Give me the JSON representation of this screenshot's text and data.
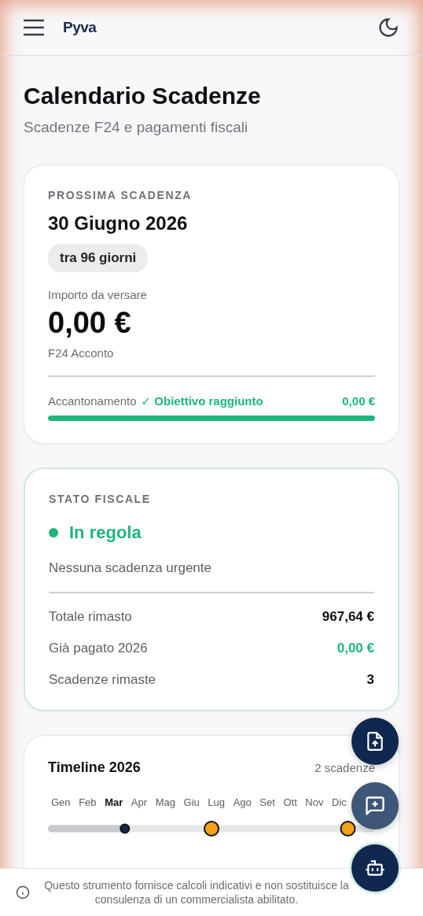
{
  "header": {
    "logo": "Pyva"
  },
  "page": {
    "title": "Calendario Scadenze",
    "subtitle": "Scadenze F24 e pagamenti fiscali"
  },
  "next_deadline": {
    "label": "PROSSIMA SCADENZA",
    "date": "30 Giugno 2026",
    "countdown": "tra 96 giorni",
    "amount_label": "Importo da versare",
    "amount": "0,00 €",
    "type": "F24 Acconto",
    "savings_label": "Accantonamento",
    "savings_status": "✓ Obiettivo raggiunto",
    "savings_amount": "0,00 €",
    "level": 1
  },
  "fiscal_status": {
    "label": "STATO FISCALE",
    "status": "In regola",
    "color": "#1fb57d",
    "note": "Nessuna scadenza urgente",
    "rows": [
      {
        "label": "Totale rimasto",
        "value": "967,64 €",
        "kind": "plain"
      },
      {
        "label": "Già pagato 2026",
        "value": "0,00 €",
        "kind": "positive"
      },
      {
        "label": "Scadenze rimaste",
        "value": "3",
        "kind": "plain"
      }
    ]
  },
  "timeline": {
    "title": "Timeline 2026",
    "count": "2 scadenze",
    "level": 0.235,
    "markers": [
      {
        "level": 0.5
      },
      {
        "level": 0.917
      }
    ],
    "months": [
      {
        "label": "Gen",
        "selected": false
      },
      {
        "label": "Feb",
        "selected": false
      },
      {
        "label": "Mar",
        "selected": true
      },
      {
        "label": "Apr",
        "selected": false
      },
      {
        "label": "Mag",
        "selected": false
      },
      {
        "label": "Giu",
        "selected": false
      },
      {
        "label": "Lug",
        "selected": false
      },
      {
        "label": "Ago",
        "selected": false
      },
      {
        "label": "Set",
        "selected": false
      },
      {
        "label": "Ott",
        "selected": false
      },
      {
        "label": "Nov",
        "selected": false
      },
      {
        "label": "Dic",
        "selected": false
      }
    ]
  },
  "disclaimer": "Questo strumento fornisce calcoli indicativi e non sostituisce la consulenza di un commercialista abilitato."
}
